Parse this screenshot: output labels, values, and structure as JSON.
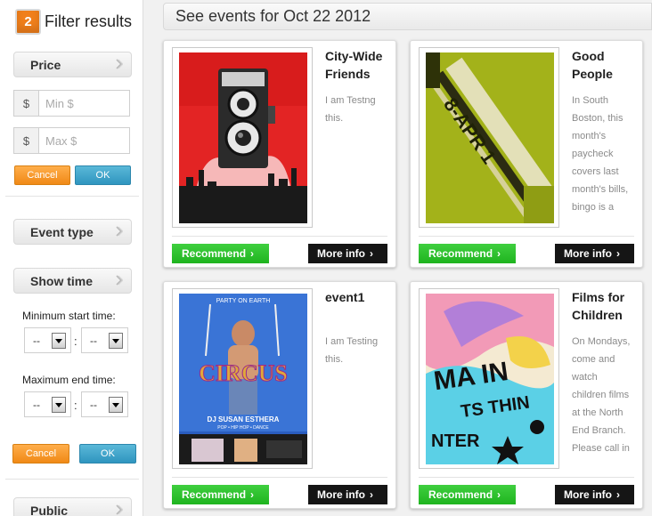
{
  "sidebar": {
    "step_number": "2",
    "title": "Filter results",
    "price": {
      "label": "Price",
      "currency_symbol": "$",
      "min_placeholder": "Min $",
      "max_placeholder": "Max $",
      "cancel_label": "Cancel",
      "ok_label": "OK"
    },
    "event_type_label": "Event type",
    "show_time": {
      "label": "Show time",
      "min_start_label": "Minimum start time:",
      "max_end_label": "Maximum end time:",
      "hour_value": "--",
      "minute_value": "--",
      "separator": ":",
      "cancel_label": "Cancel",
      "ok_label": "OK"
    },
    "public_label": "Public"
  },
  "main": {
    "heading": "See events for Oct 22 2012",
    "recommend_label": "Recommend",
    "more_info_label": "More info",
    "events": [
      {
        "title": "City-Wide Friends",
        "description": "I am Testng this."
      },
      {
        "title": "Good People",
        "description": "In South Boston, this month's paycheck covers last month's bills, bingo is a"
      },
      {
        "title": "event1",
        "description": "I am Testing this."
      },
      {
        "title": "Films for Children",
        "description": "On Mondays, come and watch children films at the North End Branch. Please call in"
      }
    ],
    "poster_texts": {
      "good_people": "8-APR 1",
      "circus_top": "PARTY ON EARTH",
      "circus_word": "CIRCUS",
      "circus_dj": "DJ SUSAN ESTHERA",
      "circus_genre": "POP • HIP HOP • DANCE",
      "films_text": "MA IN",
      "films_sub": "TS THIN",
      "films_bottom": "NTER"
    }
  },
  "colors": {
    "accent_orange": "#f08916",
    "accent_blue": "#2f95bf",
    "recommend_green": "#1fb41f",
    "more_info_black": "#151515"
  }
}
